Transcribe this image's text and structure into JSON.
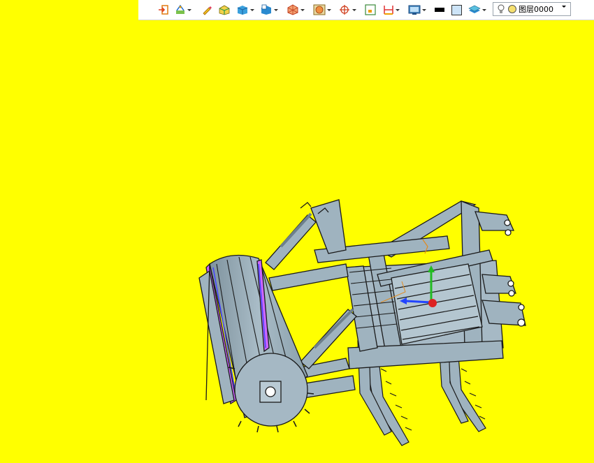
{
  "background_color": "#ffff00",
  "toolbar": {
    "buttons": [
      {
        "icon": "exit-sketch-icon"
      },
      {
        "icon": "sketch-icon"
      },
      {
        "icon": "pencil-icon"
      },
      {
        "icon": "extrude-solid-icon"
      },
      {
        "icon": "solid-cube-icon"
      },
      {
        "icon": "part-cube-icon"
      },
      {
        "icon": "view-orientation-icon"
      },
      {
        "icon": "render-style-icon"
      },
      {
        "icon": "coordinate-system-icon"
      },
      {
        "icon": "fit-view-icon"
      },
      {
        "icon": "dimension-icon"
      },
      {
        "icon": "display-settings-icon"
      },
      {
        "icon": "line-color-swatch"
      },
      {
        "icon": "fill-color-swatch"
      },
      {
        "icon": "layer-stack-icon"
      }
    ],
    "line_color": "#000000",
    "fill_color": "#cde4f7",
    "layer": {
      "bulb_icon": "lightbulb-icon",
      "state_icon": "layer-state-icon",
      "name": "图层0000"
    }
  },
  "model": {
    "body_color": "#9fb3bf",
    "edge_color": "#1a1a1a",
    "highlight_color": "#cc66ff",
    "axis_colors": {
      "x": "#2244ff",
      "y": "#22bb22",
      "z": "#dd2222"
    }
  }
}
